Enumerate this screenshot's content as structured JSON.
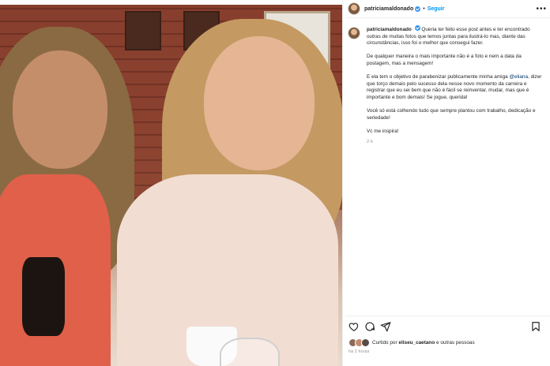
{
  "post": {
    "username": "patriciamaldonado",
    "separator": "•",
    "follow_label": "Seguir",
    "more_label": "•••"
  },
  "caption": {
    "username": "patriciamaldonado",
    "p1": "Queria ter feito esse post antes e ter encontrado outras de muitas fotos que temos juntas para ilustrá-lo mas, diante das circunstâncias, isso foi o melhor que consegui fazer.",
    "p2": "De qualquer maneira o mais importante não é a foto e nem a data da postagem, mas a mensagem!",
    "p3_before": "E ela tem o objetivo de parabenizar publicamente minha amiga",
    "mention": "@eliana",
    "p3_after": ", dizer que torço demais pelo sucesso dela nesse novo momento da carreira e registrar que eu sei bem que não é fácil se reinventar, mudar, mas que é importante e bom demais! Se jogue, querida!",
    "p4": "Você só está colhendo tudo que sempre plantou com trabalho, dedicação e seriedade!",
    "p5": "Vc me inspira!",
    "time": "2 h"
  },
  "icons": {
    "like": "heart-icon",
    "comment": "comment-icon",
    "share": "share-icon",
    "save": "bookmark-icon"
  },
  "likes": {
    "prefix": "Curtido por",
    "user": "eliseu_caetano",
    "suffix": "e outras pessoas",
    "avatar_colors": [
      "#8a6a5a",
      "#c48b6b",
      "#5a4a44"
    ]
  },
  "date": "há 2 horas"
}
